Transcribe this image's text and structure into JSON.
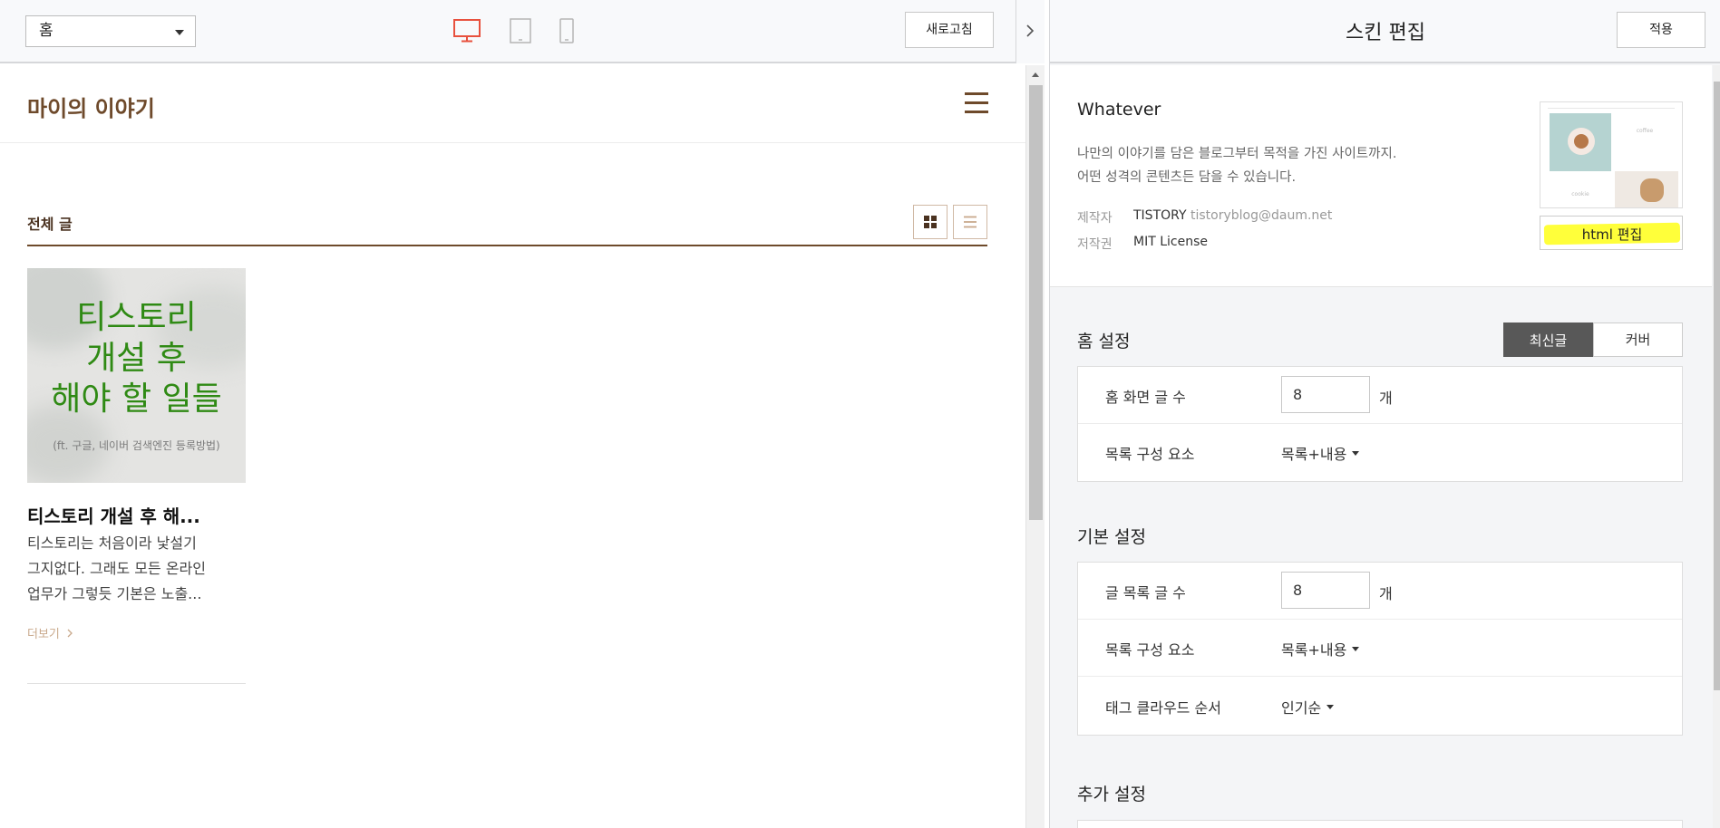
{
  "left": {
    "page_select": {
      "value": "홈"
    },
    "refresh_label": "새로고침",
    "colors": {
      "device_active": "#e8513e",
      "device_inactive": "#b5b5b5",
      "brand": "#6e4a2b"
    }
  },
  "preview": {
    "blog_title": "마이의 이야기",
    "section_title": "전체 글",
    "post": {
      "thumb_lines": [
        "티스토리",
        "개설 후",
        "해야 할 일들"
      ],
      "thumb_sub": "(ft. 구글, 네이버 검색엔진 등록방법)",
      "title": "티스토리 개설 후 해...",
      "excerpt_lines": [
        "티스토리는 처음이라 낯설기",
        "그지없다. 그래도 모든 온라인",
        "업무가 그렇듯 기본은 노출..."
      ],
      "read_more": "더보기"
    }
  },
  "right": {
    "title": "스킨 편집",
    "apply_label": "적용",
    "skin": {
      "name": "Whatever",
      "desc1": "나만의 이야기를 담은 블로그부터 목적을 가진 사이트까지.",
      "desc2": "어떤 성격의 콘텐츠든 담을 수 있습니다.",
      "maker_label": "제작자",
      "maker_name": "TISTORY",
      "maker_email": "tistoryblog@daum.net",
      "license_label": "저작권",
      "license_value": "MIT License",
      "thumb_caption": "coffee",
      "thumb_caption2": "cookie",
      "html_edit_label": "html 편집"
    },
    "home_settings": {
      "label": "홈 설정",
      "seg_latest": "최신글",
      "seg_cover": "커버",
      "post_count_label": "홈 화면 글 수",
      "post_count_value": "8",
      "unit": "개",
      "list_elements_label": "목록 구성 요소",
      "list_elements_value": "목록+내용"
    },
    "basic_settings": {
      "label": "기본 설정",
      "list_count_label": "글 목록 글 수",
      "list_count_value": "8",
      "unit": "개",
      "list_elements_label": "목록 구성 요소",
      "list_elements_value": "목록+내용",
      "tag_order_label": "태그 클라우드 순서",
      "tag_order_value": "인기순"
    },
    "extra_settings": {
      "label": "추가 설정"
    }
  }
}
